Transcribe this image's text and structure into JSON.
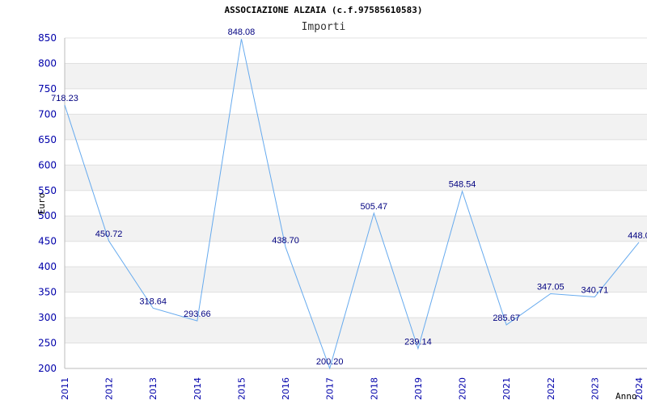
{
  "chart_data": {
    "type": "line",
    "title": "ASSOCIAZIONE ALZAIA (c.f.97585610583)",
    "subtitle": "Importi",
    "xlabel": "Anno",
    "ylabel": "Euro",
    "ylim": [
      200,
      850
    ],
    "yticks": [
      200,
      250,
      300,
      350,
      400,
      450,
      500,
      550,
      600,
      650,
      700,
      750,
      800,
      850
    ],
    "grid": true,
    "categories": [
      "2011",
      "2012",
      "2013",
      "2014",
      "2015",
      "2016",
      "2017",
      "2018",
      "2019",
      "2020",
      "2021",
      "2022",
      "2023",
      "2024"
    ],
    "series": [
      {
        "values": [
          718.23,
          450.72,
          318.64,
          293.66,
          848.08,
          438.7,
          200.2,
          505.47,
          239.14,
          548.54,
          285.67,
          347.05,
          340.71,
          448.04
        ],
        "labels": [
          "718.23",
          "450.72",
          "318.64",
          "293.66",
          "848.08",
          "438.70",
          "200.20",
          "505.47",
          "239.14",
          "548.54",
          "285.67",
          "347.05",
          "340.71",
          "448.0"
        ]
      }
    ],
    "colors": {
      "line": "#66aaee",
      "band": "#f2f2f2",
      "grid": "#e0e0e0",
      "tick_text": "#0000aa",
      "data_label": "#000080"
    }
  }
}
